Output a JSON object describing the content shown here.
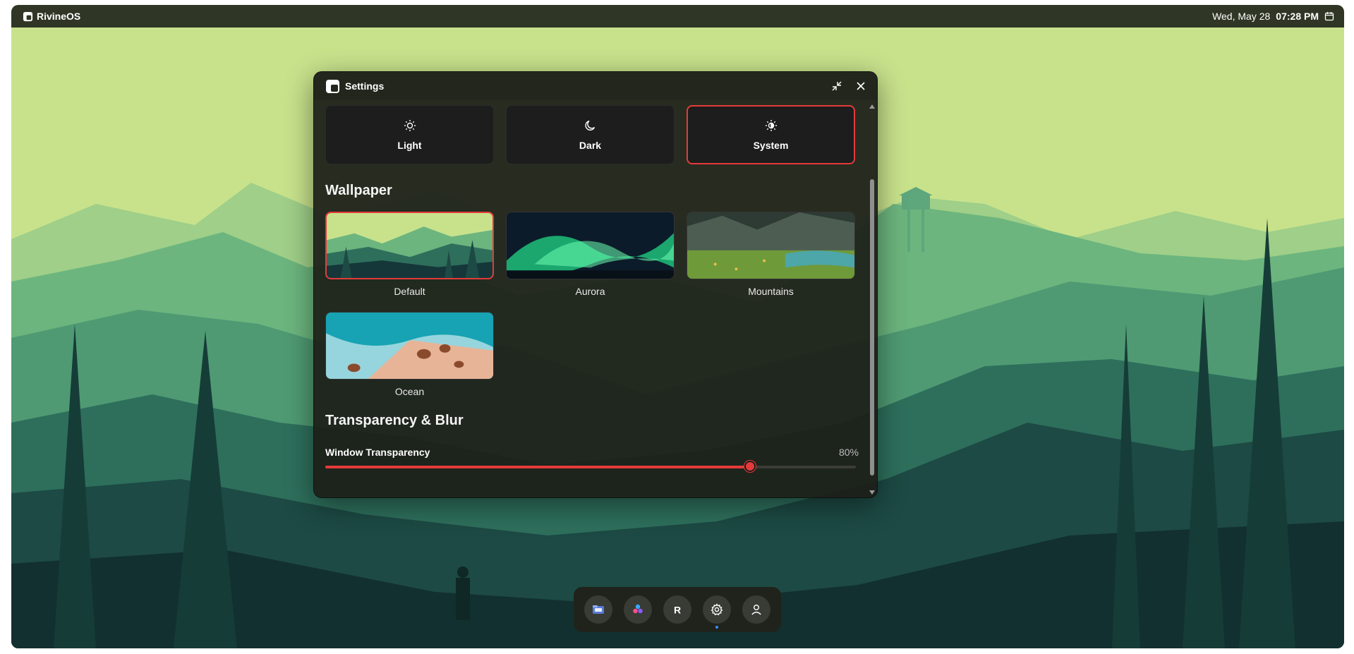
{
  "topbar": {
    "brand": "RivineOS",
    "date": "Wed, May 28",
    "time": "07:28 PM"
  },
  "window": {
    "title": "Settings",
    "themes": [
      {
        "label": "Light",
        "icon": "sun-icon",
        "selected": false
      },
      {
        "label": "Dark",
        "icon": "moon-icon",
        "selected": false
      },
      {
        "label": "System",
        "icon": "system-theme-icon",
        "selected": true
      }
    ],
    "wallpaper_title": "Wallpaper",
    "wallpapers": [
      {
        "label": "Default",
        "selected": true
      },
      {
        "label": "Aurora",
        "selected": false
      },
      {
        "label": "Mountains",
        "selected": false
      },
      {
        "label": "Ocean",
        "selected": false
      }
    ],
    "transparency_title": "Transparency & Blur",
    "transparency": {
      "label": "Window Transparency",
      "value_text": "80%",
      "value": 0.8
    }
  },
  "dock": {
    "items": [
      {
        "icon": "files-app-icon"
      },
      {
        "icon": "paint-app-icon"
      },
      {
        "icon": "rivine-app-icon"
      },
      {
        "icon": "settings-app-icon",
        "active": true
      },
      {
        "icon": "user-app-icon"
      }
    ]
  },
  "colors": {
    "accent": "#e53a3a",
    "topbar": "#2f3625",
    "sky": "#c8e28c"
  }
}
